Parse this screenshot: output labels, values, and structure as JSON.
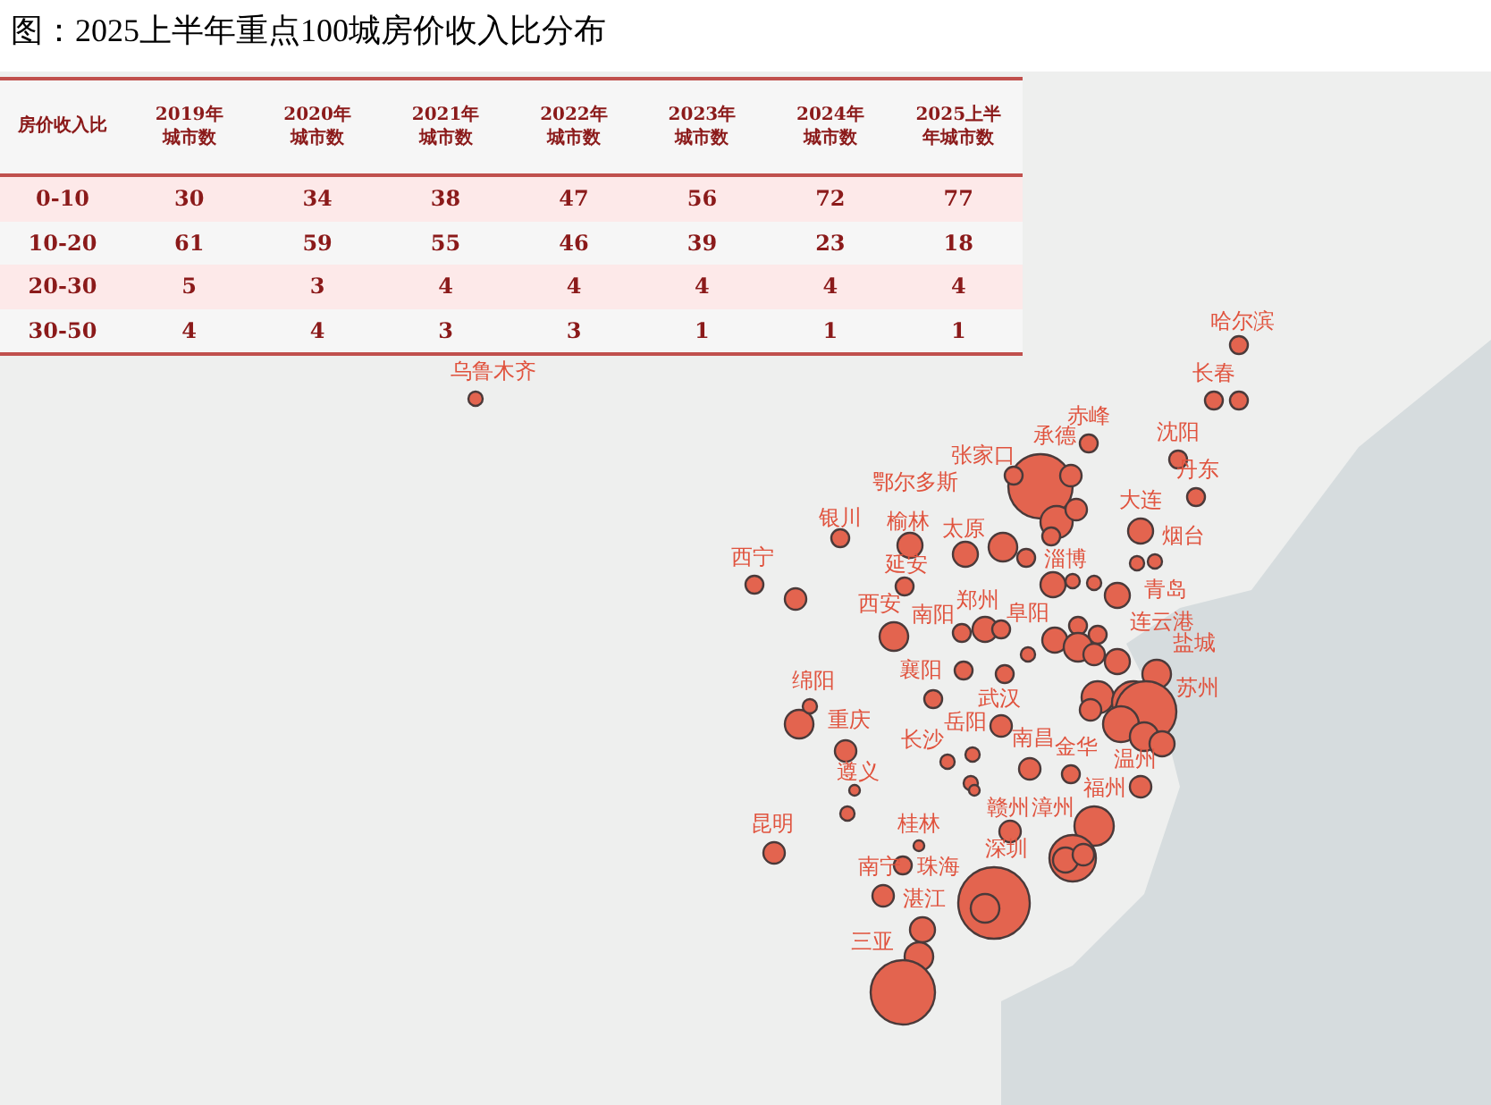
{
  "title": "图：2025上半年重点100城房价收入比分布",
  "table": {
    "columns": [
      "房价收入比",
      "2019年城市数",
      "2020年城市数",
      "2021年城市数",
      "2022年城市数",
      "2023年城市数",
      "2024年城市数",
      "2025上半年城市数"
    ],
    "rows": [
      [
        "0-10",
        "30",
        "34",
        "38",
        "47",
        "56",
        "72",
        "77"
      ],
      [
        "10-20",
        "61",
        "59",
        "55",
        "46",
        "39",
        "23",
        "18"
      ],
      [
        "20-30",
        "5",
        "3",
        "4",
        "4",
        "4",
        "4",
        "4"
      ],
      [
        "30-50",
        "4",
        "4",
        "3",
        "3",
        "1",
        "1",
        "1"
      ]
    ]
  },
  "map": {
    "city_labels": [
      "哈尔滨",
      "乌鲁木齐",
      "长春",
      "赤峰",
      "承德",
      "沈阳",
      "张家口",
      "鄂尔多斯",
      "丹东",
      "大连",
      "银川",
      "榆林",
      "太原",
      "烟台",
      "西宁",
      "延安",
      "淄博",
      "青岛",
      "西安",
      "南阳",
      "郑州",
      "阜阳",
      "连云港",
      "盐城",
      "绵阳",
      "襄阳",
      "武汉",
      "苏州",
      "重庆",
      "岳阳",
      "长沙",
      "南昌",
      "金华",
      "遵义",
      "温州",
      "福州",
      "赣州",
      "漳州",
      "昆明",
      "桂林",
      "深圳",
      "南宁",
      "珠海",
      "湛江",
      "三亚"
    ]
  }
}
